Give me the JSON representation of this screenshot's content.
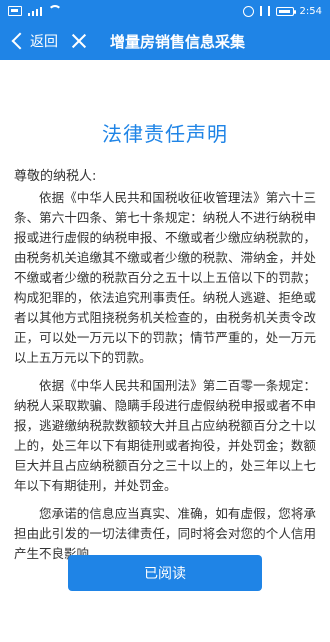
{
  "status_bar": {
    "time": "2:54"
  },
  "nav": {
    "back_label": "返回",
    "title": "增量房销售信息采集"
  },
  "content": {
    "title": "法律责任声明",
    "greeting": "尊敬的纳税人:",
    "paragraphs": [
      "依据《中华人民共和国税收征收管理法》第六十三条、第六十四条、第七十条规定：纳税人不进行纳税申报或进行虚假的纳税申报、不缴或者少缴应纳税款的，由税务机关追缴其不缴或者少缴的税款、滞纳金，并处不缴或者少缴的税款百分之五十以上五倍以下的罚款；构成犯罪的，依法追究刑事责任。纳税人逃避、拒绝或者以其他方式阻挠税务机关检查的，由税务机关责令改正，可以处一万元以下的罚款；情节严重的，处一万元以上五万元以下的罚款。",
      "依据《中华人民共和国刑法》第二百零一条规定：纳税人采取欺骗、隐瞒手段进行虚假纳税申报或者不申报，逃避缴纳税款数额较大并且占应纳税额百分之十以上的，处三年以下有期徒刑或者拘役，并处罚金；数额巨大并且占应纳税额百分之三十以上的，处三年以上七年以下有期徒刑，并处罚金。",
      "您承诺的信息应当真实、准确，如有虚假，您将承担由此引发的一切法律责任，同时将会对您的个人信用产生不良影响。"
    ],
    "read_button": "已阅读"
  },
  "colors": {
    "brand": "#1f84e6"
  }
}
